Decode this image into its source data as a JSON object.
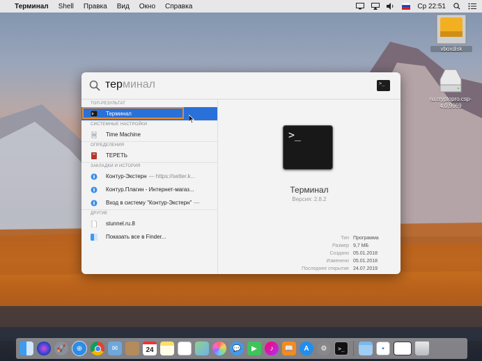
{
  "menubar": {
    "apple_glyph": "",
    "app_name": "Терминал",
    "items": [
      "Shell",
      "Правка",
      "Вид",
      "Окно",
      "Справка"
    ],
    "clock": "Ср 22:51"
  },
  "desktop_icons": [
    {
      "label": "vboxdisk"
    },
    {
      "label": "ru.cryptopro.csp-4.0.9969"
    }
  ],
  "spotlight": {
    "query_typed": "тер",
    "query_completion": "минал",
    "sections": [
      {
        "title": "ТОП-РЕЗУЛЬТАТ",
        "rows": [
          {
            "label": "Терминал",
            "icon": "terminal-icon",
            "selected": true
          }
        ]
      },
      {
        "title": "СИСТЕМНЫЕ НАСТРОЙКИ",
        "rows": [
          {
            "label": "Time Machine",
            "icon": "time-machine-icon"
          }
        ]
      },
      {
        "title": "ОПРЕДЕЛЕНИЯ",
        "rows": [
          {
            "label": "ТЕРЕТЬ",
            "icon": "dictionary-icon"
          }
        ]
      },
      {
        "title": "ЗАКЛАДКИ И ИСТОРИЯ",
        "rows": [
          {
            "label": "Контур-Экстерн",
            "sub": "— https://setter.k...",
            "icon": "safari-icon"
          },
          {
            "label": "Контур.Плагин - Интернет-магаз...",
            "icon": "safari-icon"
          },
          {
            "label": "Вход в систему \"Контур-Экстерн\"",
            "sub": "—",
            "icon": "safari-icon"
          }
        ]
      },
      {
        "title": "ДРУГИЕ",
        "rows": [
          {
            "label": "stunnel.ru.8",
            "icon": "document-icon"
          },
          {
            "label": "Показать все в Finder...",
            "icon": "finder-icon"
          }
        ]
      }
    ],
    "preview": {
      "prompt_glyph": ">_",
      "name": "Терминал",
      "version": "Версия: 2.8.2",
      "meta": [
        {
          "k": "Тип",
          "v": "Программа"
        },
        {
          "k": "Размер",
          "v": "9,7 МБ"
        },
        {
          "k": "Создано",
          "v": "05.01.2018"
        },
        {
          "k": "Изменено",
          "v": "05.01.2018"
        },
        {
          "k": "Последнее открытие",
          "v": "24.07.2019"
        }
      ]
    }
  },
  "dock": {
    "calendar_day": "24",
    "apps": [
      "finder-icon",
      "siri-icon",
      "launchpad-icon",
      "safari-icon",
      "chrome-icon",
      "mail-icon",
      "contacts-icon",
      "calendar-icon",
      "notes-icon",
      "reminders-icon",
      "maps-icon",
      "photos-icon",
      "messages-icon",
      "facetime-icon",
      "itunes-icon",
      "ibooks-icon",
      "app-store-icon",
      "system-preferences-icon",
      "terminal-icon"
    ],
    "others": [
      "folder-icon",
      "downloads-icon",
      "window-icon",
      "trash-icon"
    ]
  },
  "colors": {
    "selection": "#2a70d9",
    "highlight_outline": "#e98a2a"
  }
}
